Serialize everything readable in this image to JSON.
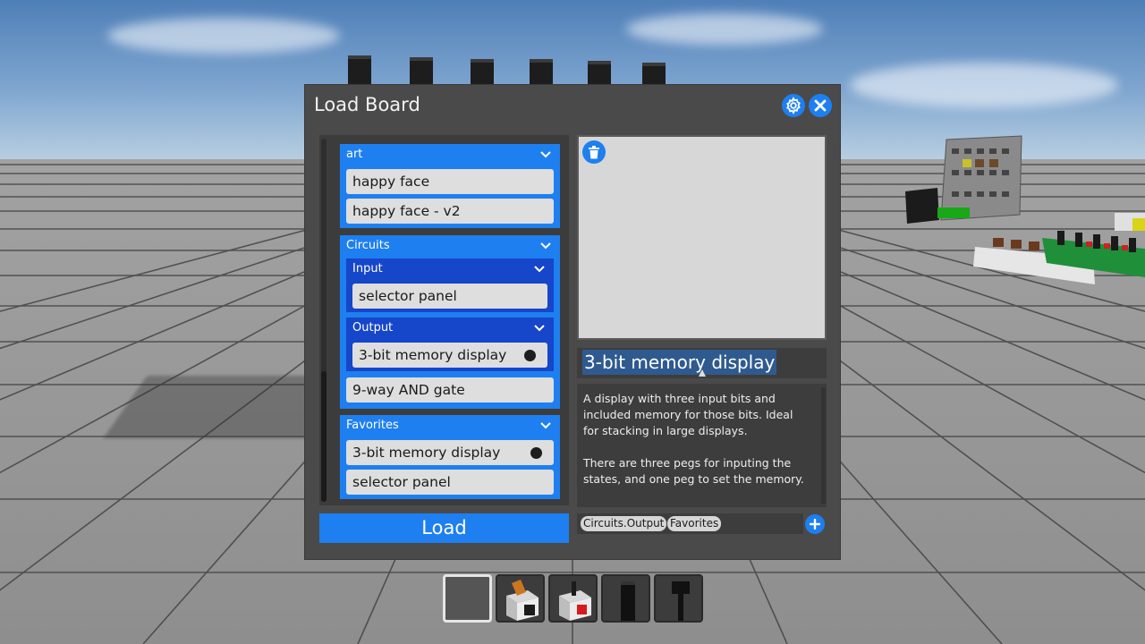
{
  "dialog": {
    "title": "Load Board",
    "settings_icon": "gear-icon",
    "close_icon": "close-icon"
  },
  "board_list": {
    "categories": [
      {
        "name": "art",
        "items": [
          "happy face",
          "happy face - v2"
        ]
      },
      {
        "name": "Circuits",
        "subcategories": [
          {
            "name": "Input",
            "items": [
              "selector panel"
            ]
          },
          {
            "name": "Output",
            "items": [
              "3-bit memory display"
            ]
          }
        ],
        "items": [
          "9-way AND gate"
        ]
      },
      {
        "name": "Favorites",
        "items": [
          "3-bit memory display",
          "selector panel"
        ]
      }
    ]
  },
  "load_button": {
    "label": "Load"
  },
  "details": {
    "delete_icon": "trash-icon",
    "name": "3-bit memory display",
    "description_lines": [
      "A display with three input bits and",
      "included memory for those bits. Ideal",
      "for stacking in large displays.",
      "",
      "There are three pegs for inputing the",
      "states, and one peg to set the memory."
    ],
    "tags": [
      "Circuits.Output",
      "Favorites"
    ],
    "add_tag_icon": "plus-icon"
  },
  "hotbar": {
    "slots": 5,
    "selected": 0
  },
  "colors": {
    "accent": "#1e7ff0",
    "subcategory": "#1646c9",
    "dialog_bg": "#4a4a4a",
    "item_bg": "#dedede"
  }
}
